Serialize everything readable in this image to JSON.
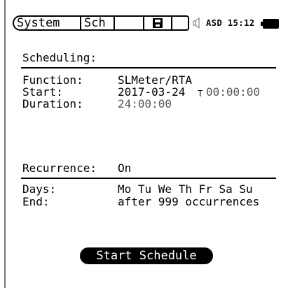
{
  "header": {
    "tabs": [
      "System",
      "Sch",
      "",
      ""
    ],
    "save_icon": "floppy-disk-icon",
    "speaker_icon": "speaker-icon",
    "battery_icon": "battery-icon",
    "status_name": "ASD",
    "clock": "15:12"
  },
  "section": {
    "title": "Scheduling:"
  },
  "details": {
    "function_label": "Function:",
    "function_value": "SLMeter/RTA",
    "start_label": "Start:",
    "start_date": "2017-03-24",
    "start_time_marker": "T",
    "start_time": "00:00:00",
    "duration_label": "Duration:",
    "duration_value": "24:00:00"
  },
  "recurrence": {
    "label": "Recurrence:",
    "value": "On",
    "days_label": "Days:",
    "days_value": "Mo Tu We Th Fr Sa Su",
    "end_label": "End:",
    "end_value": "after 999 occurrences"
  },
  "actions": {
    "start_schedule": "Start Schedule"
  }
}
